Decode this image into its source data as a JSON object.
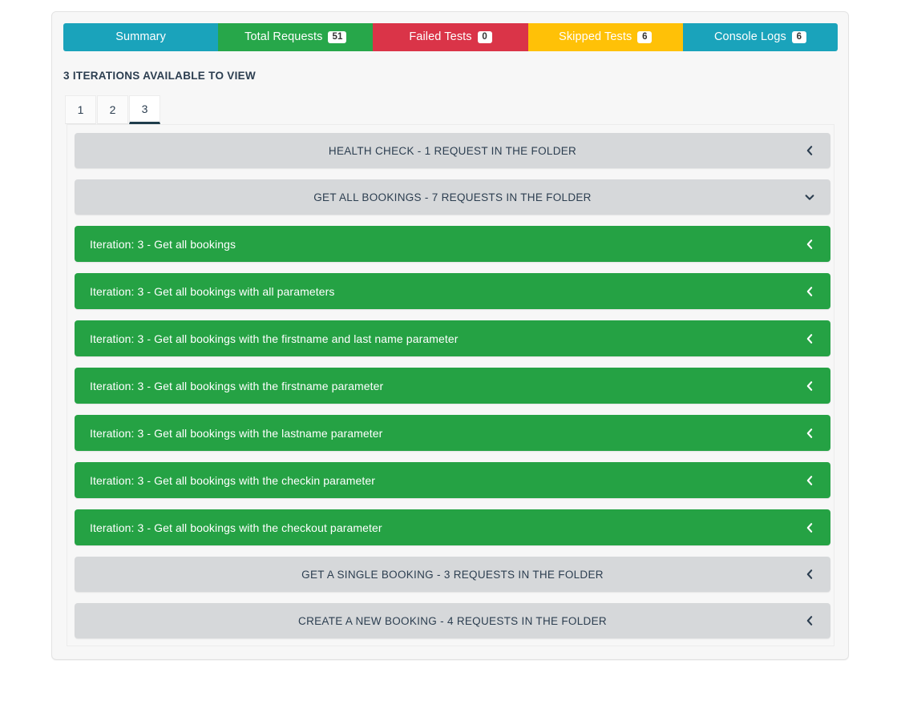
{
  "tabs": [
    {
      "label": "Summary",
      "badge": null,
      "color": "#1aa3bb",
      "name": "tab-summary"
    },
    {
      "label": "Total Requests",
      "badge": "51",
      "color": "#27a74a",
      "name": "tab-total-requests"
    },
    {
      "label": "Failed Tests",
      "badge": "0",
      "color": "#da3448",
      "name": "tab-failed-tests"
    },
    {
      "label": "Skipped Tests",
      "badge": "6",
      "color": "#ffc107",
      "name": "tab-skipped-tests"
    },
    {
      "label": "Console Logs",
      "badge": "6",
      "color": "#1aa3bb",
      "name": "tab-console-logs"
    }
  ],
  "iterations": {
    "heading": "3 ITERATIONS AVAILABLE TO VIEW",
    "tabs": [
      "1",
      "2",
      "3"
    ],
    "active": "3"
  },
  "rows": [
    {
      "type": "folder",
      "title": "HEALTH CHECK - 1 REQUEST IN THE FOLDER",
      "chevron": "chevron-left-icon"
    },
    {
      "type": "folder",
      "title": "GET ALL BOOKINGS - 7 REQUESTS IN THE FOLDER",
      "chevron": "chevron-down-icon"
    },
    {
      "type": "request",
      "title": "Iteration: 3 - Get all bookings",
      "chevron": "chevron-left-icon"
    },
    {
      "type": "request",
      "title": "Iteration: 3 - Get all bookings with all parameters",
      "chevron": "chevron-left-icon"
    },
    {
      "type": "request",
      "title": "Iteration: 3 - Get all bookings with the firstname and last name parameter",
      "chevron": "chevron-left-icon"
    },
    {
      "type": "request",
      "title": "Iteration: 3 - Get all bookings with the firstname parameter",
      "chevron": "chevron-left-icon"
    },
    {
      "type": "request",
      "title": "Iteration: 3 - Get all bookings with the lastname parameter",
      "chevron": "chevron-left-icon"
    },
    {
      "type": "request",
      "title": "Iteration: 3 - Get all bookings with the checkin parameter",
      "chevron": "chevron-left-icon"
    },
    {
      "type": "request",
      "title": "Iteration: 3 - Get all bookings with the checkout parameter",
      "chevron": "chevron-left-icon"
    },
    {
      "type": "folder",
      "title": "GET A SINGLE BOOKING - 3 REQUESTS IN THE FOLDER",
      "chevron": "chevron-left-icon"
    },
    {
      "type": "folder",
      "title": "CREATE A NEW BOOKING - 4 REQUESTS IN THE FOLDER",
      "chevron": "chevron-left-icon"
    }
  ],
  "colors": {
    "teal": "#1aa3bb",
    "green": "#27a74a",
    "red": "#da3448",
    "yellow": "#ffc107",
    "row_green": "#25a244",
    "row_gray": "#d6d8da",
    "panel_bg": "#f7f7f7",
    "active_underline": "#1f3d4c"
  }
}
